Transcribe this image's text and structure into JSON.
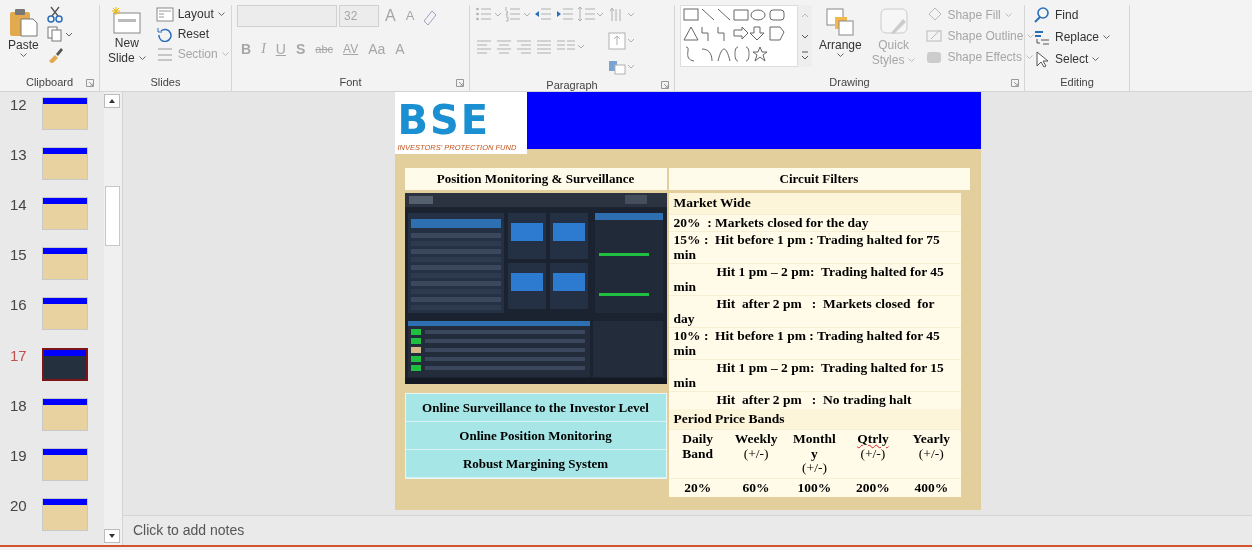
{
  "ribbon": {
    "clipboard": {
      "label": "Clipboard",
      "launcher": true,
      "paste": {
        "label": "Paste",
        "dropdown": true
      }
    },
    "slides": {
      "label": "Slides",
      "launcher": false,
      "new_slide": {
        "label": [
          "New",
          "Slide"
        ],
        "dropdown": true
      },
      "commands": [
        {
          "label": "Layout",
          "disabled": false,
          "dropdown": true
        },
        {
          "label": "Reset",
          "disabled": false,
          "dropdown": false
        },
        {
          "label": "Section",
          "disabled": true,
          "dropdown": true
        }
      ]
    },
    "font": {
      "label": "Font",
      "launcher": true,
      "disabled": true,
      "font_size": "32",
      "size_buttons": [
        {
          "label": "A",
          "kind": "grow"
        },
        {
          "label": "A",
          "kind": "shrink"
        }
      ],
      "style_buttons": [
        {
          "label": "B",
          "kind": "bold"
        },
        {
          "label": "I",
          "kind": "italic"
        },
        {
          "label": "U",
          "kind": "underline"
        },
        {
          "label": "S",
          "kind": "shadow"
        },
        {
          "label": "abc",
          "kind": "strike"
        },
        {
          "label": "AV",
          "kind": "spacing"
        },
        {
          "label": "Aa",
          "kind": "case"
        },
        {
          "label": "A",
          "kind": "color"
        }
      ]
    },
    "paragraph": {
      "label": "Paragraph",
      "launcher": true,
      "disabled": true
    },
    "drawing": {
      "label": "Drawing",
      "launcher": true,
      "arrange": {
        "label": "Arrange",
        "disabled": false
      },
      "quick_styles": {
        "label": [
          "Quick",
          "Styles"
        ],
        "disabled": true
      },
      "commands": [
        {
          "label": "Shape Fill",
          "disabled": true
        },
        {
          "label": "Shape Outline",
          "disabled": true
        },
        {
          "label": "Shape Effects",
          "disabled": true
        }
      ]
    },
    "editing": {
      "label": "Editing",
      "launcher": false,
      "commands": [
        {
          "label": "Find",
          "dropdown": false
        },
        {
          "label": "Replace",
          "dropdown": true
        },
        {
          "label": "Select",
          "dropdown": true
        }
      ]
    }
  },
  "slide_thumbnails": [
    {
      "number": "12",
      "selected": false
    },
    {
      "number": "13",
      "selected": false
    },
    {
      "number": "14",
      "selected": false
    },
    {
      "number": "15",
      "selected": false
    },
    {
      "number": "16",
      "selected": false
    },
    {
      "number": "17",
      "selected": true
    },
    {
      "number": "18",
      "selected": false
    },
    {
      "number": "19",
      "selected": false
    },
    {
      "number": "20",
      "selected": false
    }
  ],
  "slide": {
    "logo": {
      "mark": "BSE",
      "tagline": "INVESTORS' PROTECTION FUND"
    },
    "left_panel": {
      "heading": "Position Monitoring & Surveillance",
      "features": [
        "Online Surveillance to the Investor Level",
        "Online Position Monitoring",
        "Robust Margining System"
      ]
    },
    "right_panel": {
      "heading": "Circuit Filters",
      "market_wide": {
        "title": "Market Wide",
        "lines": [
          {
            "text": "20%  : Markets closed for the day",
            "kind": "rule"
          },
          {
            "text": "15% :  Hit before 1 pm : Trading halted for 75 min",
            "kind": "rule"
          },
          {
            "text": "Hit 1 pm – 2 pm:  Trading halted for 45 min",
            "kind": "sub"
          },
          {
            "text": "Hit  after 2 pm   :  Markets closed  for day",
            "kind": "sub"
          },
          {
            "text": "10% :  Hit before 1 pm : Trading halted for 45 min",
            "kind": "rule"
          },
          {
            "text": "Hit 1 pm – 2 pm:  Trading halted for 15 min",
            "kind": "sub"
          },
          {
            "text": "Hit  after 2 pm   :  No trading halt",
            "kind": "sub"
          }
        ]
      },
      "price_bands": {
        "title": "Period Price Bands",
        "columns": [
          {
            "name": "Daily Band",
            "misspelled": false
          },
          {
            "name": "Weekly",
            "unit": "(+/-)",
            "misspelled": false
          },
          {
            "name": "Monthly",
            "unit": "(+/-)",
            "misspelled": false
          },
          {
            "name": "Qtrly",
            "unit": "(+/-)",
            "misspelled": true
          },
          {
            "name": "Yearly",
            "unit": "(+/-)",
            "misspelled": false
          }
        ],
        "values": [
          "20%",
          "60%",
          "100%",
          "200%",
          "400%"
        ]
      }
    }
  },
  "notes": {
    "placeholder": "Click to add notes"
  }
}
